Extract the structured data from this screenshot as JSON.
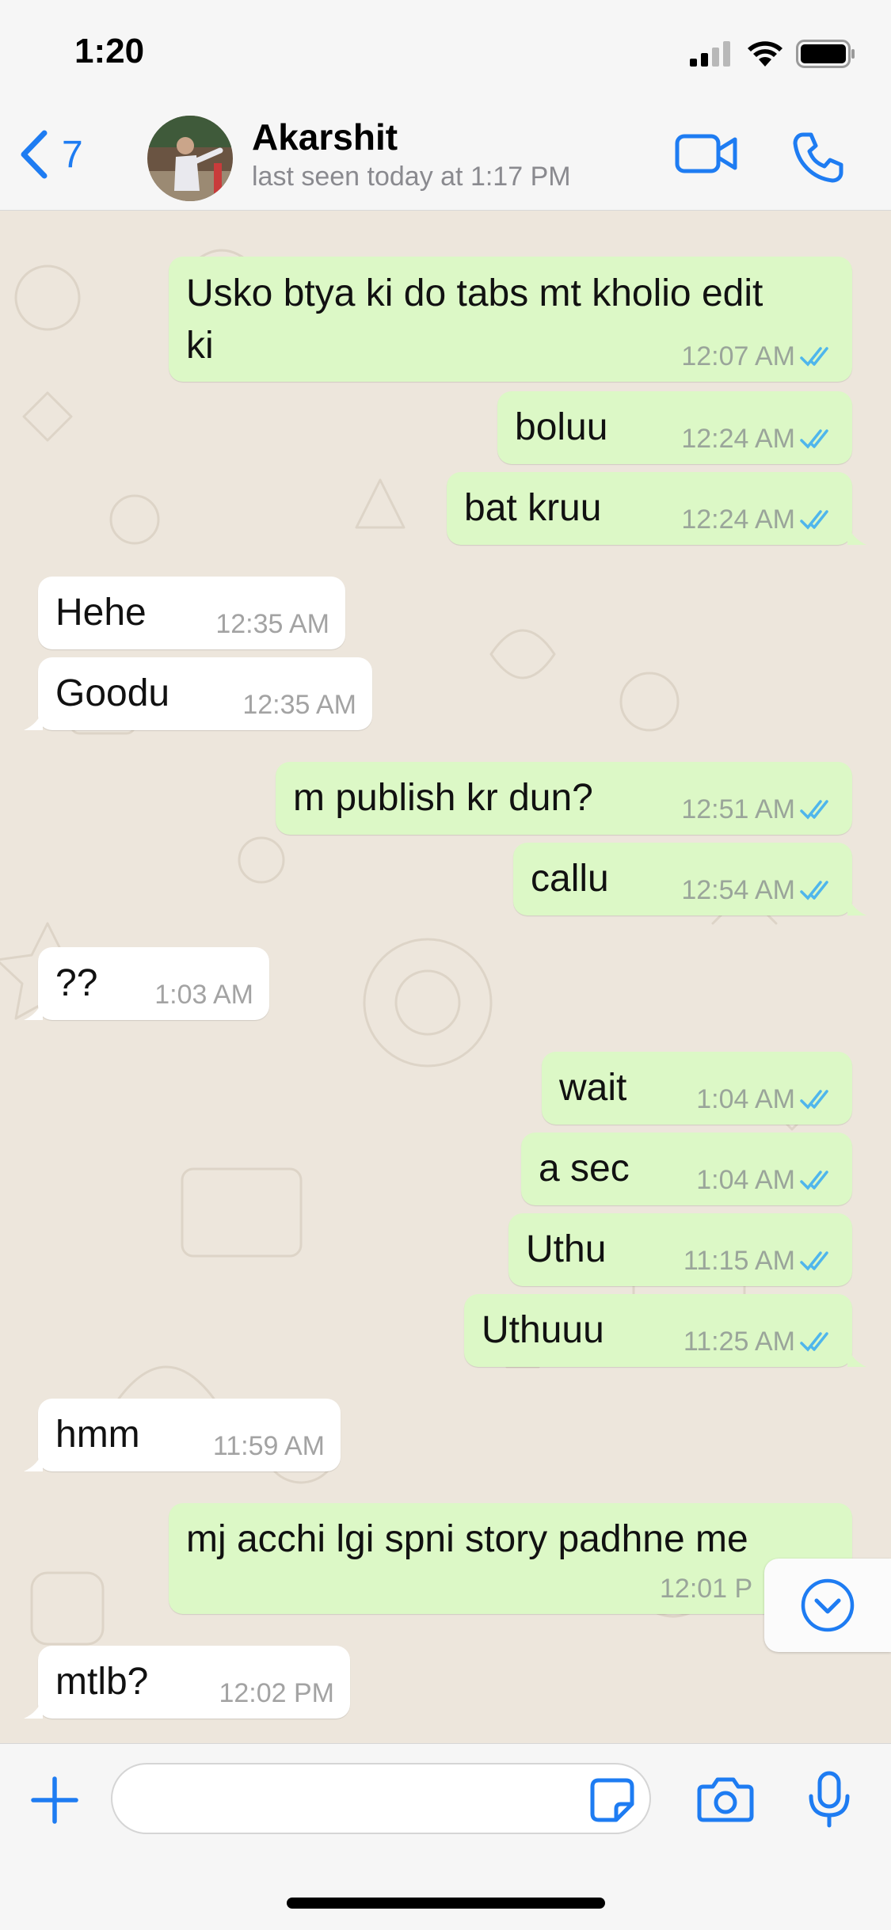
{
  "status_bar": {
    "time": "1:20"
  },
  "header": {
    "back_count": "7",
    "contact_name": "Akarshit",
    "contact_status": "last seen today at 1:17 PM"
  },
  "messages": [
    {
      "dir": "out",
      "text_line1": "Usko btya ki do tabs mt kholio edit",
      "text_line2": "ki",
      "time": "12:07 AM",
      "status": "read"
    },
    {
      "dir": "out",
      "text": "boluu",
      "time": "12:24 AM",
      "status": "read"
    },
    {
      "dir": "out",
      "text": "bat kruu",
      "time": "12:24 AM",
      "status": "read"
    },
    {
      "dir": "in",
      "text": "Hehe",
      "time": "12:35 AM"
    },
    {
      "dir": "in",
      "text": "Goodu",
      "time": "12:35 AM"
    },
    {
      "dir": "out",
      "text": "m publish kr dun?",
      "time": "12:51 AM",
      "status": "read"
    },
    {
      "dir": "out",
      "text": "callu",
      "time": "12:54 AM",
      "status": "read"
    },
    {
      "dir": "in",
      "text": "??",
      "time": "1:03 AM"
    },
    {
      "dir": "out",
      "text": "wait",
      "time": "1:04 AM",
      "status": "read"
    },
    {
      "dir": "out",
      "text": "a sec",
      "time": "1:04 AM",
      "status": "read"
    },
    {
      "dir": "out",
      "text": "Uthu",
      "time": "11:15 AM",
      "status": "read"
    },
    {
      "dir": "out",
      "text": "Uthuuu",
      "time": "11:25 AM",
      "status": "read"
    },
    {
      "dir": "in",
      "text": "hmm",
      "time": "11:59 AM"
    },
    {
      "dir": "out",
      "text": "mj acchi lgi spni story padhne me",
      "time": "12:01 P",
      "status": "read"
    },
    {
      "dir": "in",
      "text": "mtlb?",
      "time": "12:02 PM"
    }
  ],
  "input": {
    "placeholder": ""
  },
  "colors": {
    "accent": "#1e7cf2",
    "outgoing_bubble": "#dcf8c6",
    "incoming_bubble": "#ffffff",
    "read_ticks": "#4fb6ec",
    "chat_background": "#ede6dc"
  },
  "icons": {
    "back": "chevron-left-icon",
    "video_call": "video-camera-icon",
    "voice_call": "phone-icon",
    "add": "plus-icon",
    "sticker": "sticker-icon",
    "camera": "camera-icon",
    "mic": "microphone-icon",
    "scroll_down": "chevron-down-circle-icon",
    "read_receipt": "double-check-icon"
  }
}
